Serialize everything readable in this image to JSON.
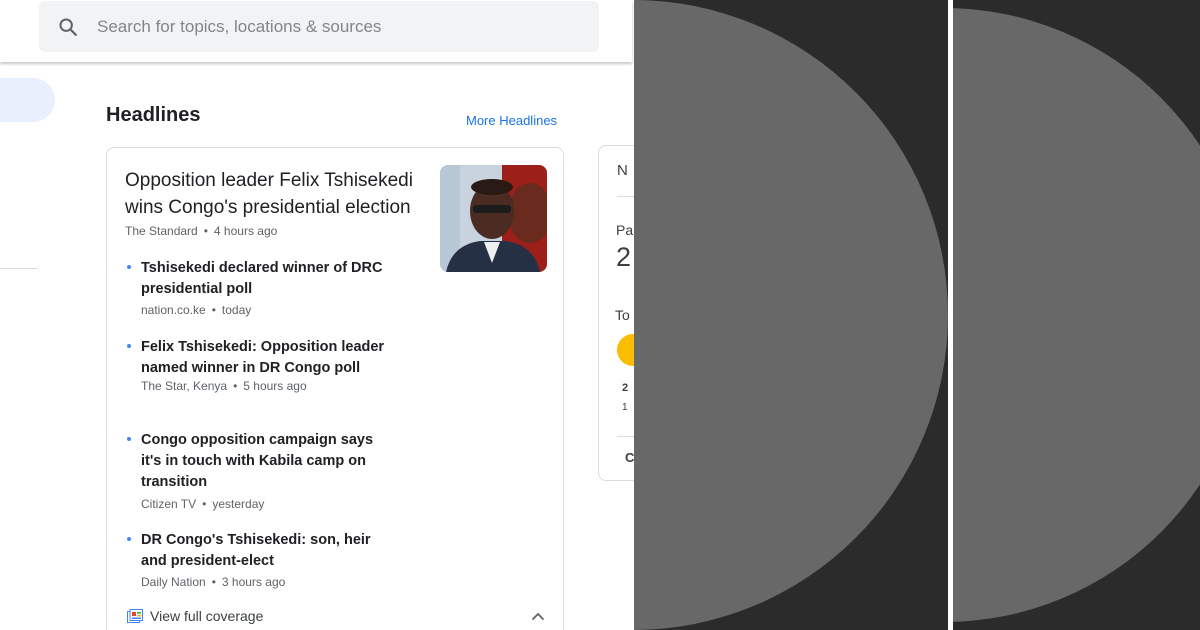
{
  "search": {
    "placeholder": "Search for topics, locations & sources"
  },
  "headlines": {
    "section_title": "Headlines",
    "more_link": "More Headlines",
    "main_story": {
      "title": "Opposition leader Felix Tshisekedi wins Congo's presidential election",
      "source": "The Standard",
      "time": "4 hours ago"
    },
    "related": [
      {
        "title": "Tshisekedi declared winner of DRC presidential poll",
        "source": "nation.co.ke",
        "time": "today"
      },
      {
        "title": "Felix Tshisekedi: Opposition leader named winner in DR Congo poll",
        "source": "The Star, Kenya",
        "time": "5 hours ago"
      },
      {
        "title": "Congo opposition campaign says it's in touch with Kabila camp on transition",
        "source": "Citizen TV",
        "time": "yesterday"
      },
      {
        "title": "DR Congo's Tshisekedi: son, heir and president-elect",
        "source": "Daily Nation",
        "time": "3 hours ago"
      }
    ],
    "coverage_label": "View full coverage"
  },
  "side_card": {
    "title_fragment": "N",
    "label_1": "Pa",
    "value_1": "2",
    "label_2": "To",
    "row_a": "2",
    "row_b": "1",
    "row_c": "C"
  },
  "icons": {
    "search": "search-icon",
    "coverage": "full-coverage-icon",
    "chevron": "chevron-up-icon"
  },
  "colors": {
    "link": "#1a73e8",
    "bullet": "#4285f4",
    "overlay_bg": "#2b2b2b",
    "overlay_circle": "#686868",
    "weather_sun": "#fbbc04"
  }
}
